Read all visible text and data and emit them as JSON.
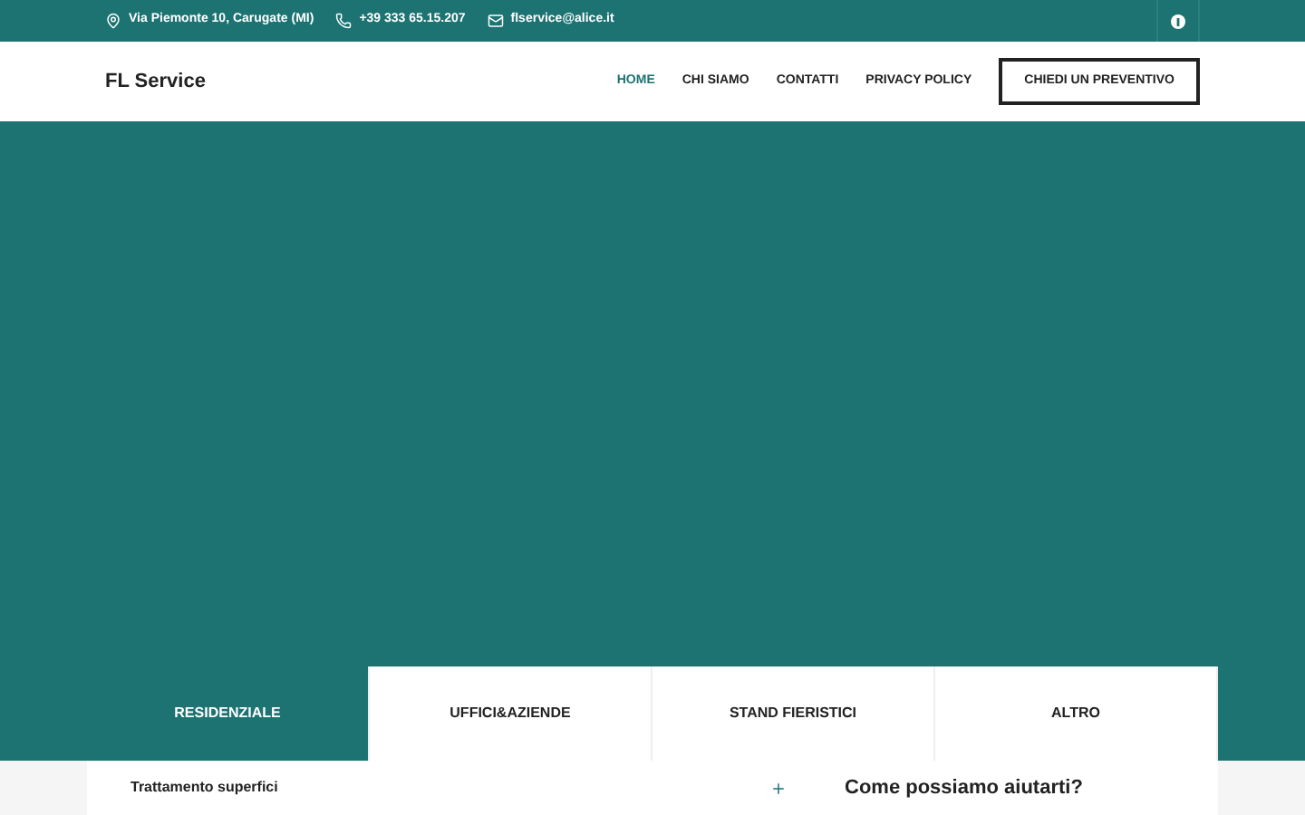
{
  "top_bar": {
    "address": "Via Piemonte 10, Carugate (MI)",
    "phone": "+39 333 65.15.207",
    "email": "flservice@alice.it"
  },
  "header": {
    "logo": "FL Service",
    "nav": [
      {
        "label": "HOME",
        "selected": true
      },
      {
        "label": "CHI SIAMO",
        "selected": false
      },
      {
        "label": "CONTATTI",
        "selected": false
      },
      {
        "label": "PRIVACY POLICY",
        "selected": false
      }
    ],
    "cta": "CHIEDI UN PREVENTIVO"
  },
  "tabs": [
    {
      "label": "RESIDENZIALE",
      "selected": true
    },
    {
      "label": "UFFICI&AZIENDE",
      "selected": false
    },
    {
      "label": "STAND FIERISTICI",
      "selected": false
    },
    {
      "label": "ALTRO",
      "selected": false
    }
  ],
  "accordion": [
    {
      "title": "Trattamento superfici",
      "expanded": false
    }
  ],
  "help_title": "Come possiamo aiutarti?"
}
